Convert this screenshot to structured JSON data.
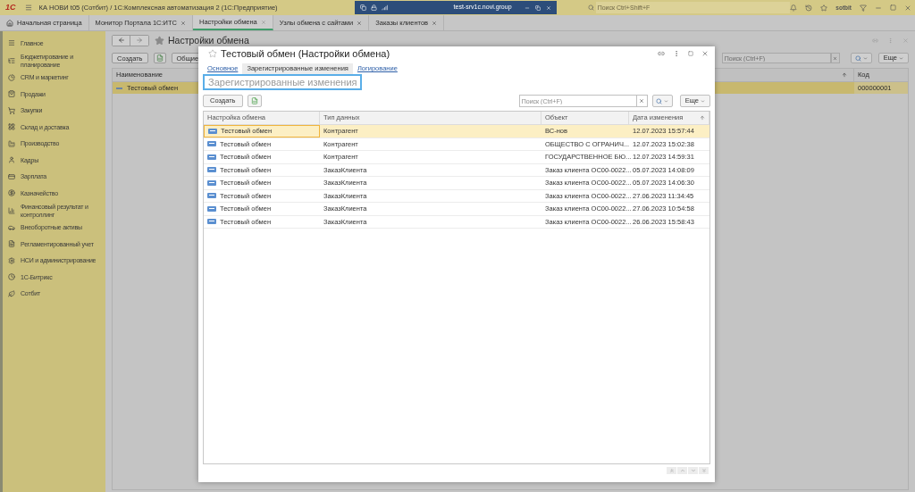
{
  "title_bar": {
    "logo": "1С",
    "title": "КА НОВИ t05 (Сотбит) / 1С:Комплексная автоматизация 2  (1С:Предприятие)",
    "remote_title": "test-srv1c.novi.group",
    "search": {
      "placeholder": "Поиск Ctrl+Shift+F"
    },
    "user": "sotbit"
  },
  "tabs": [
    {
      "label": "Начальная страница",
      "selected": false
    },
    {
      "label": "Монитор Портала 1С:ИТС",
      "selected": false
    },
    {
      "label": "Настройки обмена",
      "selected": true
    },
    {
      "label": "Узлы обмена с сайтами",
      "selected": false
    },
    {
      "label": "Заказы клиентов",
      "selected": false
    }
  ],
  "sidebar": {
    "items": [
      {
        "label": "Главное"
      },
      {
        "label": "Бюджетирование и планирование"
      },
      {
        "label": "CRM и маркетинг"
      },
      {
        "label": "Продажи"
      },
      {
        "label": "Закупки"
      },
      {
        "label": "Склад и доставка"
      },
      {
        "label": "Производство"
      },
      {
        "label": "Кадры"
      },
      {
        "label": "Зарплата"
      },
      {
        "label": "Казначейство"
      },
      {
        "label": "Финансовый результат и контроллинг"
      },
      {
        "label": "Внеоборотные активы"
      },
      {
        "label": "Регламентированный учет"
      },
      {
        "label": "НСИ и администрирование"
      },
      {
        "label": "1С-Битрикс"
      },
      {
        "label": "Сотбит"
      }
    ]
  },
  "back_form": {
    "title": "Настройки обмена",
    "buttons": [
      "Создать",
      "Общие"
    ],
    "search": {
      "placeholder": "Поиск (Ctrl+F)"
    },
    "more_button": "Еще",
    "columns": [
      "Наименование",
      "Код"
    ],
    "rows": [
      {
        "name": "Тестовый обмен",
        "code": "000000001",
        "selected": true
      }
    ]
  },
  "dialog": {
    "title": "Тестовый обмен (Настройки обмена)",
    "tabs": [
      {
        "label": "Основное",
        "selected": false
      },
      {
        "label": "Зарегистрированные изменения",
        "selected": true
      },
      {
        "label": "Логирование",
        "selected": false
      }
    ],
    "section_title": "Зарегистрированные изменения",
    "create_button": "Создать",
    "search": {
      "placeholder": "Поиск (Ctrl+F)"
    },
    "more_button": "Еще",
    "columns": [
      "Настройка обмена",
      "Тип данных",
      "Объект",
      "Дата изменения"
    ],
    "rows": [
      {
        "setting": "Тестовый обмен",
        "type": "Контрагент",
        "object": "ВС-нов",
        "date": "12.07.2023 15:57:44",
        "selected": true
      },
      {
        "setting": "Тестовый обмен",
        "type": "Контрагент",
        "object": "ОБЩЕСТВО С ОГРАНИЧ...",
        "date": "12.07.2023 15:02:38",
        "selected": false
      },
      {
        "setting": "Тестовый обмен",
        "type": "Контрагент",
        "object": "ГОСУДАРСТВЕННОЕ БЮ...",
        "date": "12.07.2023 14:59:31",
        "selected": false
      },
      {
        "setting": "Тестовый обмен",
        "type": "ЗаказКлиента",
        "object": "Заказ клиента ОС00-0022...",
        "date": "05.07.2023 14:08:09",
        "selected": false
      },
      {
        "setting": "Тестовый обмен",
        "type": "ЗаказКлиента",
        "object": "Заказ клиента ОС00-0022...",
        "date": "05.07.2023 14:06:30",
        "selected": false
      },
      {
        "setting": "Тестовый обмен",
        "type": "ЗаказКлиента",
        "object": "Заказ клиента ОС00-0022...",
        "date": "27.06.2023 11:34:45",
        "selected": false
      },
      {
        "setting": "Тестовый обмен",
        "type": "ЗаказКлиента",
        "object": "Заказ клиента ОС00-0022...",
        "date": "27.06.2023 10:54:58",
        "selected": false
      },
      {
        "setting": "Тестовый обмен",
        "type": "ЗаказКлиента",
        "object": "Заказ клиента ОС00-0022...",
        "date": "26.06.2023 15:58:43",
        "selected": false
      }
    ]
  }
}
